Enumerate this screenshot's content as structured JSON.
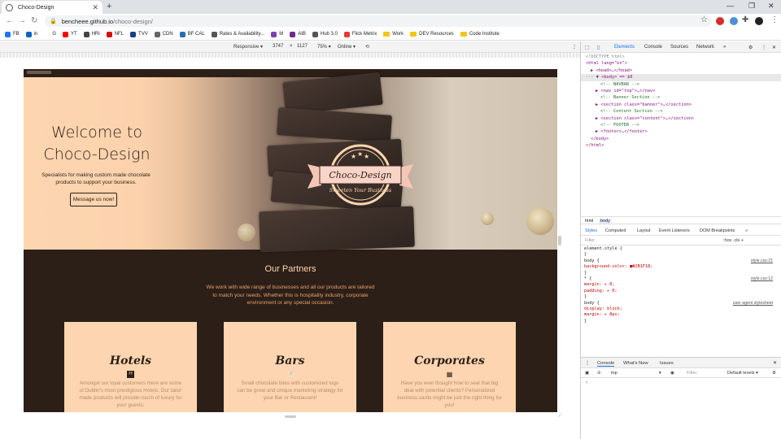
{
  "browser": {
    "tab_title": "Choco-Design",
    "url_host": "bencheee.github.io",
    "url_path": "/choco-design/",
    "bookmarks": [
      {
        "label": "FB",
        "color": "#1877f2",
        "kind": "site"
      },
      {
        "label": "in",
        "color": "#0a66c2",
        "kind": "site"
      },
      {
        "label": "G",
        "color": "#ffffff",
        "kind": "site"
      },
      {
        "label": "YT",
        "color": "#ff0000",
        "kind": "site"
      },
      {
        "label": "HRi",
        "color": "#444444",
        "kind": "site"
      },
      {
        "label": "NFL",
        "color": "#d50a0a",
        "kind": "site"
      },
      {
        "label": "TVV",
        "color": "#1b3c8a",
        "kind": "site"
      },
      {
        "label": "CDN",
        "color": "#666666",
        "kind": "site"
      },
      {
        "label": "BF CAL",
        "color": "#2b6cb0",
        "kind": "site"
      },
      {
        "label": "Rates & Availability...",
        "color": "#555555",
        "kind": "site"
      },
      {
        "label": "M",
        "color": "#7b3fb5",
        "kind": "site"
      },
      {
        "label": "AIB",
        "color": "#6b2c91",
        "kind": "site"
      },
      {
        "label": "Hub 3.0",
        "color": "#555555",
        "kind": "site"
      },
      {
        "label": "Flick Metrix",
        "color": "#e53935",
        "kind": "site"
      },
      {
        "label": "Work",
        "color": "#f5c518",
        "kind": "folder"
      },
      {
        "label": "DEV Resources",
        "color": "#f5c518",
        "kind": "folder"
      },
      {
        "label": "Code Institute",
        "color": "#f5c518",
        "kind": "folder"
      }
    ]
  },
  "device_toolbar": {
    "device": "Responsive ▾",
    "width": "3747",
    "times": "×",
    "height": "1127",
    "zoom": "75% ▾",
    "network": "Online ▾"
  },
  "site": {
    "hero_title_line1": "Welcome to",
    "hero_title_line2": "Choco-Design",
    "hero_subtitle": "Specialists for making custom made chocolate products to support your business.",
    "hero_button": "Message us now!",
    "logo_title": "Choco-Design",
    "logo_tagline": "Sweeten Your Business",
    "partners_title": "Our Partners",
    "partners_text": "We work with wide range of businesses and all our products are tailored to match your needs. Whether this is hospitality industry, corporate environment or any special occasion.",
    "cards": [
      {
        "title": "Hotels",
        "icon": "H",
        "text": "Amongst our loyal customers there are some of Dublin's most prestigious Hotels. Our tailor made products will provide touch of luxury for your guests."
      },
      {
        "title": "Bars",
        "icon": "🍸",
        "text": "Small chocolate bites with customized logo can be great and unique marketing strategy for your Bar or Restaurant!"
      },
      {
        "title": "Corporates",
        "icon": "▦",
        "text": "Have you ever thought how to seal that big deal with potential clients? Personalized business cards might be just the right thing for you!"
      }
    ]
  },
  "devtools": {
    "tabs": [
      "Elements",
      "Console",
      "Sources",
      "Network",
      "»"
    ],
    "dom": [
      {
        "t": "<!DOCTYPE html>",
        "c": "dim",
        "i": 0
      },
      {
        "t": "<html lang=\"en\">",
        "c": "tag",
        "i": 0
      },
      {
        "t": "▶ <head>…</head>",
        "c": "tag",
        "i": 1
      },
      {
        "t": "··· ▼ <body> == $0",
        "c": "tag",
        "i": 0
      },
      {
        "t": "<!-- NAVBAR -->",
        "c": "cmt",
        "i": 3
      },
      {
        "t": "▶ <nav id=\"top\">…</nav>",
        "c": "tag",
        "i": 2
      },
      {
        "t": "<!-- Banner Section -->",
        "c": "cmt",
        "i": 3
      },
      {
        "t": "▶ <section class=\"banner\">…</section>",
        "c": "tag",
        "i": 2
      },
      {
        "t": "<!-- Content Section -->",
        "c": "cmt",
        "i": 3
      },
      {
        "t": "▶ <section class=\"content\">…</section>",
        "c": "tag",
        "i": 2
      },
      {
        "t": "<!-- FOOTER -->",
        "c": "cmt",
        "i": 3
      },
      {
        "t": "▶ <footer>…</footer>",
        "c": "tag",
        "i": 2
      },
      {
        "t": "</body>",
        "c": "tag",
        "i": 1
      },
      {
        "t": "</html>",
        "c": "tag",
        "i": 0
      }
    ],
    "crumbs": [
      "html",
      "body"
    ],
    "subtabs": [
      "Styles",
      "Computed",
      "Layout",
      "Event Listeners",
      "DOM Breakpoints",
      "»"
    ],
    "filter_placeholder": "Filter",
    "filter_tools": ":hov  .cls  +",
    "styles": [
      {
        "t": "element.style {",
        "src": ""
      },
      {
        "t": "}",
        "src": ""
      },
      {
        "t": "body {",
        "src": "style.css:21"
      },
      {
        "t": "  background-color: ■#2B1F18;",
        "src": "",
        "prop": true
      },
      {
        "t": "}",
        "src": ""
      },
      {
        "t": "* {",
        "src": "style.css:12"
      },
      {
        "t": "  margin: ▸ 0;",
        "src": "",
        "prop": true
      },
      {
        "t": "  padding: ▸ 0;",
        "src": "",
        "prop": true
      },
      {
        "t": "}",
        "src": ""
      },
      {
        "t": "body {",
        "src": "user agent stylesheet"
      },
      {
        "t": "  display: block;",
        "src": "",
        "prop": true
      },
      {
        "t": "  margin: ▸ 8px;",
        "src": "",
        "prop": true
      },
      {
        "t": "}",
        "src": ""
      }
    ],
    "drawer_tabs": [
      "Console",
      "What's New",
      "Issues"
    ],
    "console_context": "top",
    "console_filter": "Filter",
    "console_levels": "Default levels ▾",
    "prompt": "›"
  },
  "colors": {
    "chocolate": "#2b1f18",
    "peach": "#fdd6b1",
    "accent_text": "#e8a06a"
  }
}
